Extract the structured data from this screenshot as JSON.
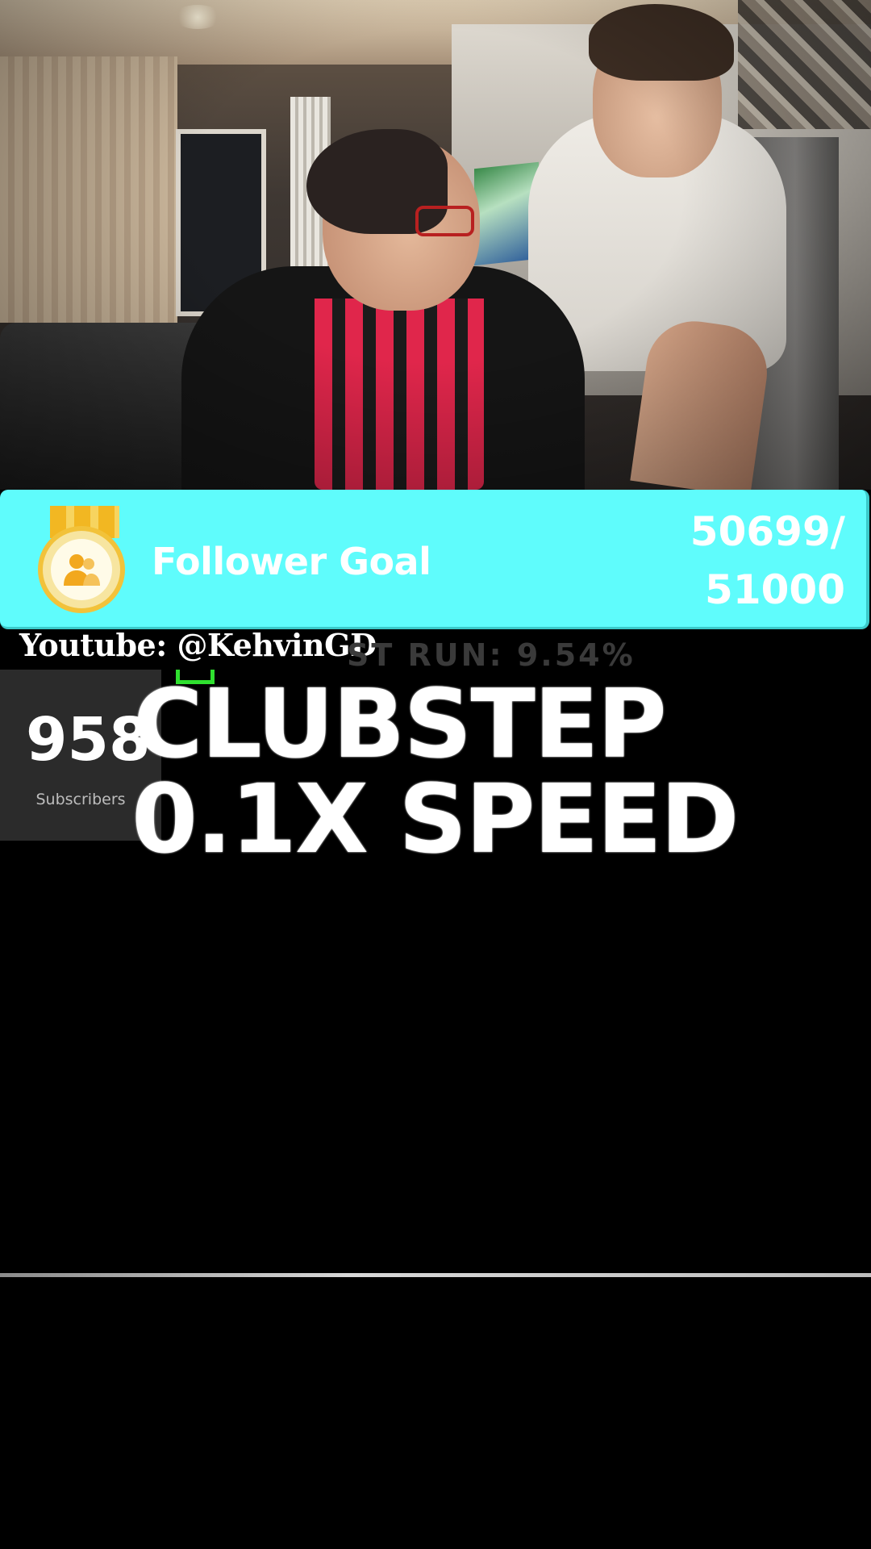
{
  "follower_goal": {
    "label": "Follower Goal",
    "current": "50699/",
    "target": "51000",
    "progress": 0.994,
    "color": "#5ffcfc"
  },
  "overlay": {
    "youtube_handle": "Youtube: @KehvinGD",
    "best_run": "ST RUN: 9.54%",
    "subscriber_count": "958",
    "subscriber_label": "Subscribers",
    "title_line1": "CLUBSTEP",
    "title_line2": "0.1X SPEED"
  },
  "icons": {
    "goal_icon": "followers-medal-icon"
  },
  "colors": {
    "background": "#000000",
    "accent_green": "#2fe02f"
  }
}
